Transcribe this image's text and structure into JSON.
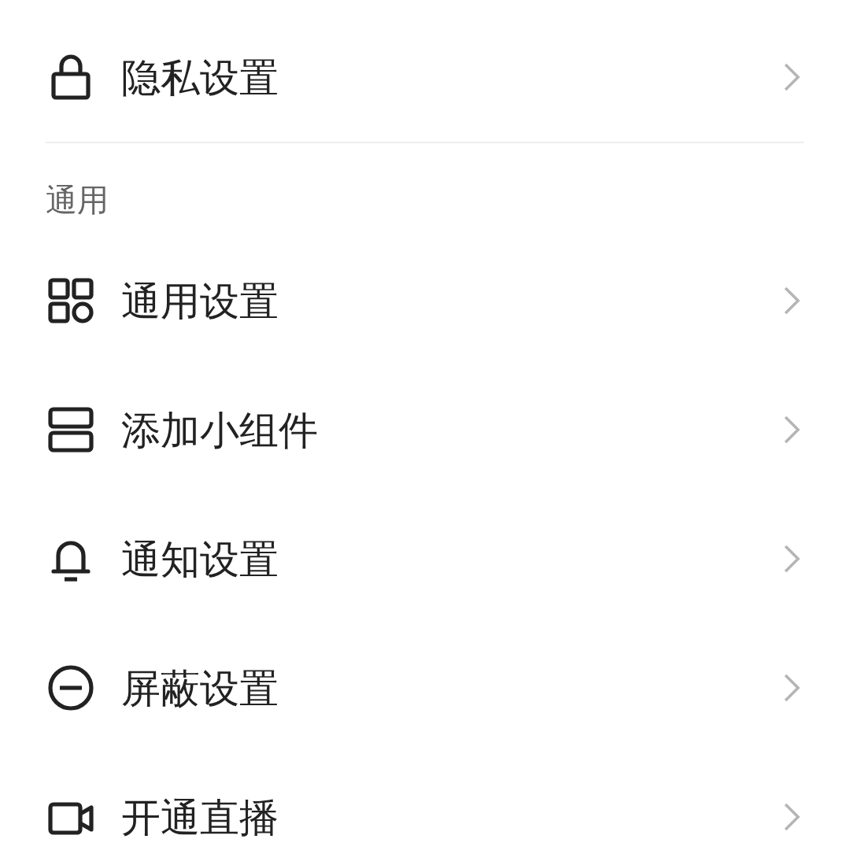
{
  "sections": [
    {
      "items": [
        {
          "kind": "lock",
          "label": "隐私设置"
        }
      ]
    },
    {
      "header": "通用",
      "items": [
        {
          "kind": "apps",
          "label": "通用设置"
        },
        {
          "kind": "widget",
          "label": "添加小组件"
        },
        {
          "kind": "bell",
          "label": "通知设置"
        },
        {
          "kind": "block",
          "label": "屏蔽设置"
        },
        {
          "kind": "live",
          "label": "开通直播"
        }
      ]
    }
  ]
}
